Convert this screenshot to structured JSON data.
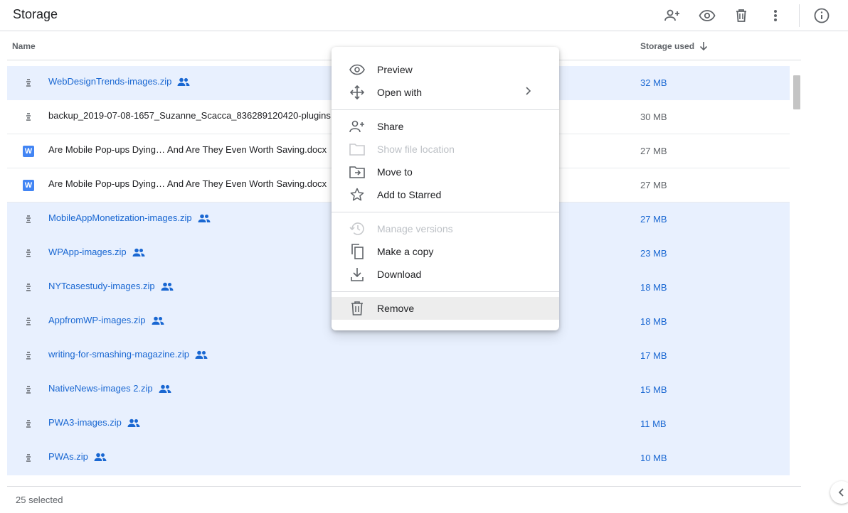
{
  "header": {
    "title": "Storage",
    "toolbar_icons": [
      "share-add-person-icon",
      "preview-eye-icon",
      "trash-icon",
      "more-vert-icon",
      "info-icon"
    ]
  },
  "columns": {
    "name": "Name",
    "storage_used": "Storage used"
  },
  "files": [
    {
      "name": "WebDesignTrends-images.zip",
      "size": "32 MB",
      "selected": true,
      "type": "zip",
      "shared": true
    },
    {
      "name": "backup_2019-07-08-1657_Suzanne_Scacca_836289120420-plugins.zip",
      "size": "30 MB",
      "selected": false,
      "type": "zip",
      "shared": false
    },
    {
      "name": "Are Mobile Pop-ups Dying… And Are They Even Worth Saving.docx",
      "size": "27 MB",
      "selected": false,
      "type": "docx",
      "shared": true
    },
    {
      "name": "Are Mobile Pop-ups Dying… And Are They Even Worth Saving.docx",
      "size": "27 MB",
      "selected": false,
      "type": "docx",
      "shared": true
    },
    {
      "name": "MobileAppMonetization-images.zip",
      "size": "27 MB",
      "selected": true,
      "type": "zip",
      "shared": true
    },
    {
      "name": "WPApp-images.zip",
      "size": "23 MB",
      "selected": true,
      "type": "zip",
      "shared": true
    },
    {
      "name": "NYTcasestudy-images.zip",
      "size": "18 MB",
      "selected": true,
      "type": "zip",
      "shared": true
    },
    {
      "name": "AppfromWP-images.zip",
      "size": "18 MB",
      "selected": true,
      "type": "zip",
      "shared": true
    },
    {
      "name": "writing-for-smashing-magazine.zip",
      "size": "17 MB",
      "selected": true,
      "type": "zip",
      "shared": true
    },
    {
      "name": "NativeNews-images 2.zip",
      "size": "15 MB",
      "selected": true,
      "type": "zip",
      "shared": true
    },
    {
      "name": "PWA3-images.zip",
      "size": "11 MB",
      "selected": true,
      "type": "zip",
      "shared": true
    },
    {
      "name": "PWAs.zip",
      "size": "10 MB",
      "selected": true,
      "type": "zip",
      "shared": true
    }
  ],
  "doc_letter": "W",
  "footer": {
    "selected_count": "25 selected"
  },
  "context_menu": {
    "preview": "Preview",
    "open_with": "Open with",
    "share": "Share",
    "show_file_location": "Show file location",
    "move_to": "Move to",
    "add_to_starred": "Add to Starred",
    "manage_versions": "Manage versions",
    "make_a_copy": "Make a copy",
    "download": "Download",
    "remove": "Remove"
  },
  "colors": {
    "selection_bg": "#e8f0fe",
    "selection_text": "#1967d2",
    "disabled_text": "#bdc1c6",
    "doc_blue": "#4285f4"
  }
}
